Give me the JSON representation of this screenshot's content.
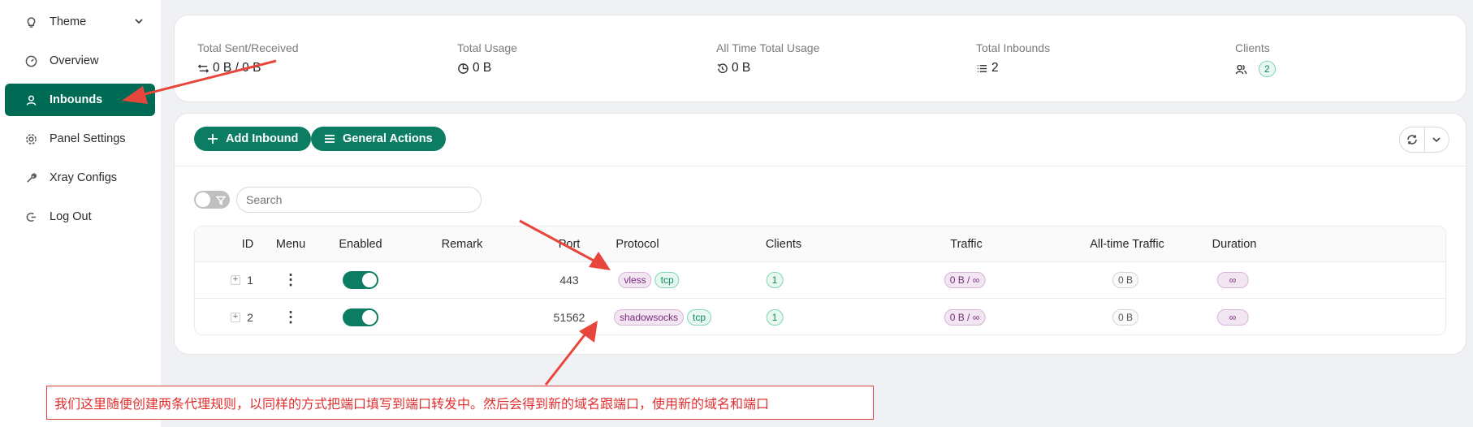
{
  "sidebar": {
    "items": [
      {
        "label": "Theme",
        "icon": "lightbulb-icon"
      },
      {
        "label": "Overview",
        "icon": "dashboard-icon"
      },
      {
        "label": "Inbounds",
        "icon": "user-icon",
        "active": true
      },
      {
        "label": "Panel Settings",
        "icon": "gear-icon"
      },
      {
        "label": "Xray Configs",
        "icon": "wrench-icon"
      },
      {
        "label": "Log Out",
        "icon": "logout-icon"
      }
    ]
  },
  "stats": {
    "sent_received": {
      "label": "Total Sent/Received",
      "value": "0 B / 0 B"
    },
    "usage": {
      "label": "Total Usage",
      "value": "0 B"
    },
    "all_time": {
      "label": "All Time Total Usage",
      "value": "0 B"
    },
    "inbounds": {
      "label": "Total Inbounds",
      "value": "2"
    },
    "clients": {
      "label": "Clients",
      "value": "2"
    }
  },
  "toolbar": {
    "add_label": "Add Inbound",
    "general_label": "General Actions"
  },
  "search": {
    "placeholder": "Search"
  },
  "table": {
    "columns": [
      "ID",
      "Menu",
      "Enabled",
      "Remark",
      "Port",
      "Protocol",
      "Clients",
      "Traffic",
      "All-time Traffic",
      "Duration"
    ],
    "rows": [
      {
        "id": "1",
        "remark": "",
        "port": "443",
        "protocol": "vless",
        "transport": "tcp",
        "clients": "1",
        "traffic": "0 B / ∞",
        "all_time": "0 B",
        "duration": "∞"
      },
      {
        "id": "2",
        "remark": "",
        "port": "51562",
        "protocol": "shadowsocks",
        "transport": "tcp",
        "clients": "1",
        "traffic": "0 B / ∞",
        "all_time": "0 B",
        "duration": "∞"
      }
    ]
  },
  "annotation": {
    "text": "我们这里随便创建两条代理规则，以同样的方式把端口填写到端口转发中。然后会得到新的域名跟端口，使用新的域名和端口",
    "color": "#e23b3b"
  },
  "colors": {
    "accent": "#0c7d63",
    "sidebar_active": "#006b54"
  }
}
